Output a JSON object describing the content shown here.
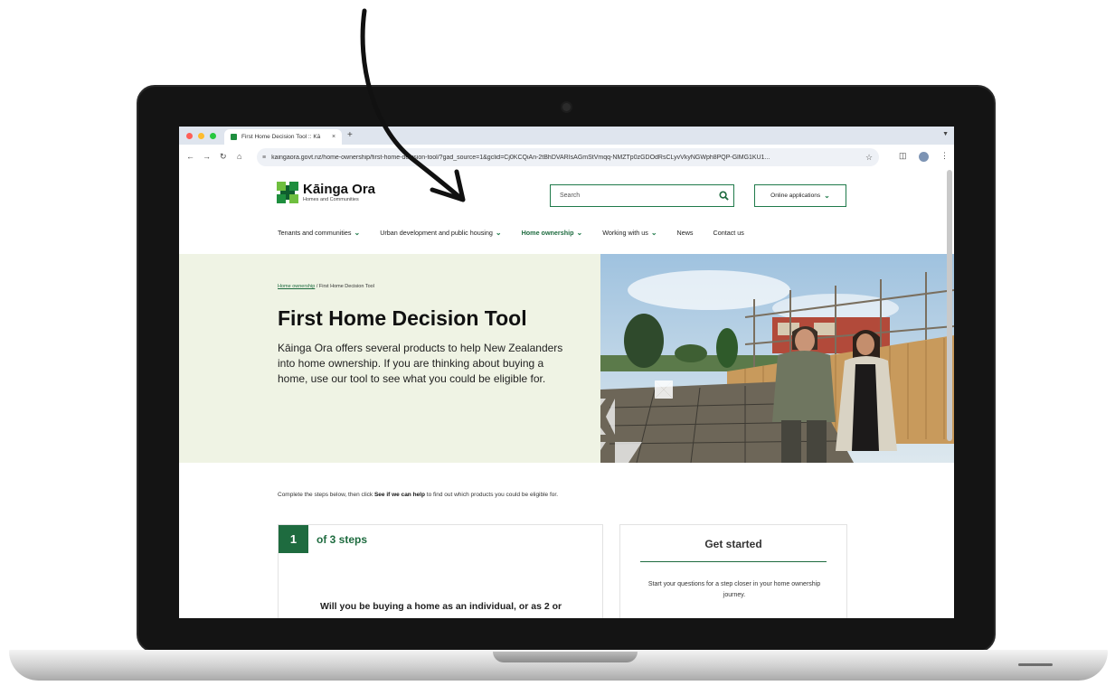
{
  "browser": {
    "tab_title": "First Home Decision Tool :: Kā",
    "tab_close": "×",
    "new_tab": "+",
    "url": "kaingaora.govt.nz/home-ownership/first-home-decision-tool/?gad_source=1&gclid=Cj0KCQiAn-2tBhDVARIsAGmStVmqq-NMZTp0zGDOdRsCLyvVkyNGWph8PQP-GlMG1KU1..."
  },
  "site": {
    "logo": {
      "name": "Kāinga Ora",
      "subtitle": "Homes and Communities"
    },
    "search": {
      "placeholder": "Search"
    },
    "online_applications": "Online applications",
    "nav": [
      {
        "label": "Tenants and communities"
      },
      {
        "label": "Urban development and public housing"
      },
      {
        "label": "Home ownership"
      },
      {
        "label": "Working with us"
      },
      {
        "label": "News"
      },
      {
        "label": "Contact us"
      }
    ],
    "breadcrumb": {
      "parent": "Home ownership",
      "separator": "/",
      "current": "First Home Decision Tool"
    },
    "hero": {
      "title": "First Home Decision Tool",
      "description": "Kāinga Ora offers several products to help New Zealanders into home ownership. If you are thinking about buying a home, use our tool to see what you could be eligible for."
    },
    "instructions": {
      "before": "Complete the steps below, then click ",
      "bold": "See if we can help",
      "after": " to find out which products you could be eligible for."
    },
    "steps": {
      "number": "1",
      "of_label": "of 3 steps",
      "question": "Will you be buying a home as an individual, or as 2 or"
    },
    "get_started": {
      "title": "Get started",
      "description": "Start your questions for a step closer in your home ownership journey."
    }
  },
  "colors": {
    "brand_green": "#1e6b3f",
    "hero_panel": "#eff3e4"
  }
}
